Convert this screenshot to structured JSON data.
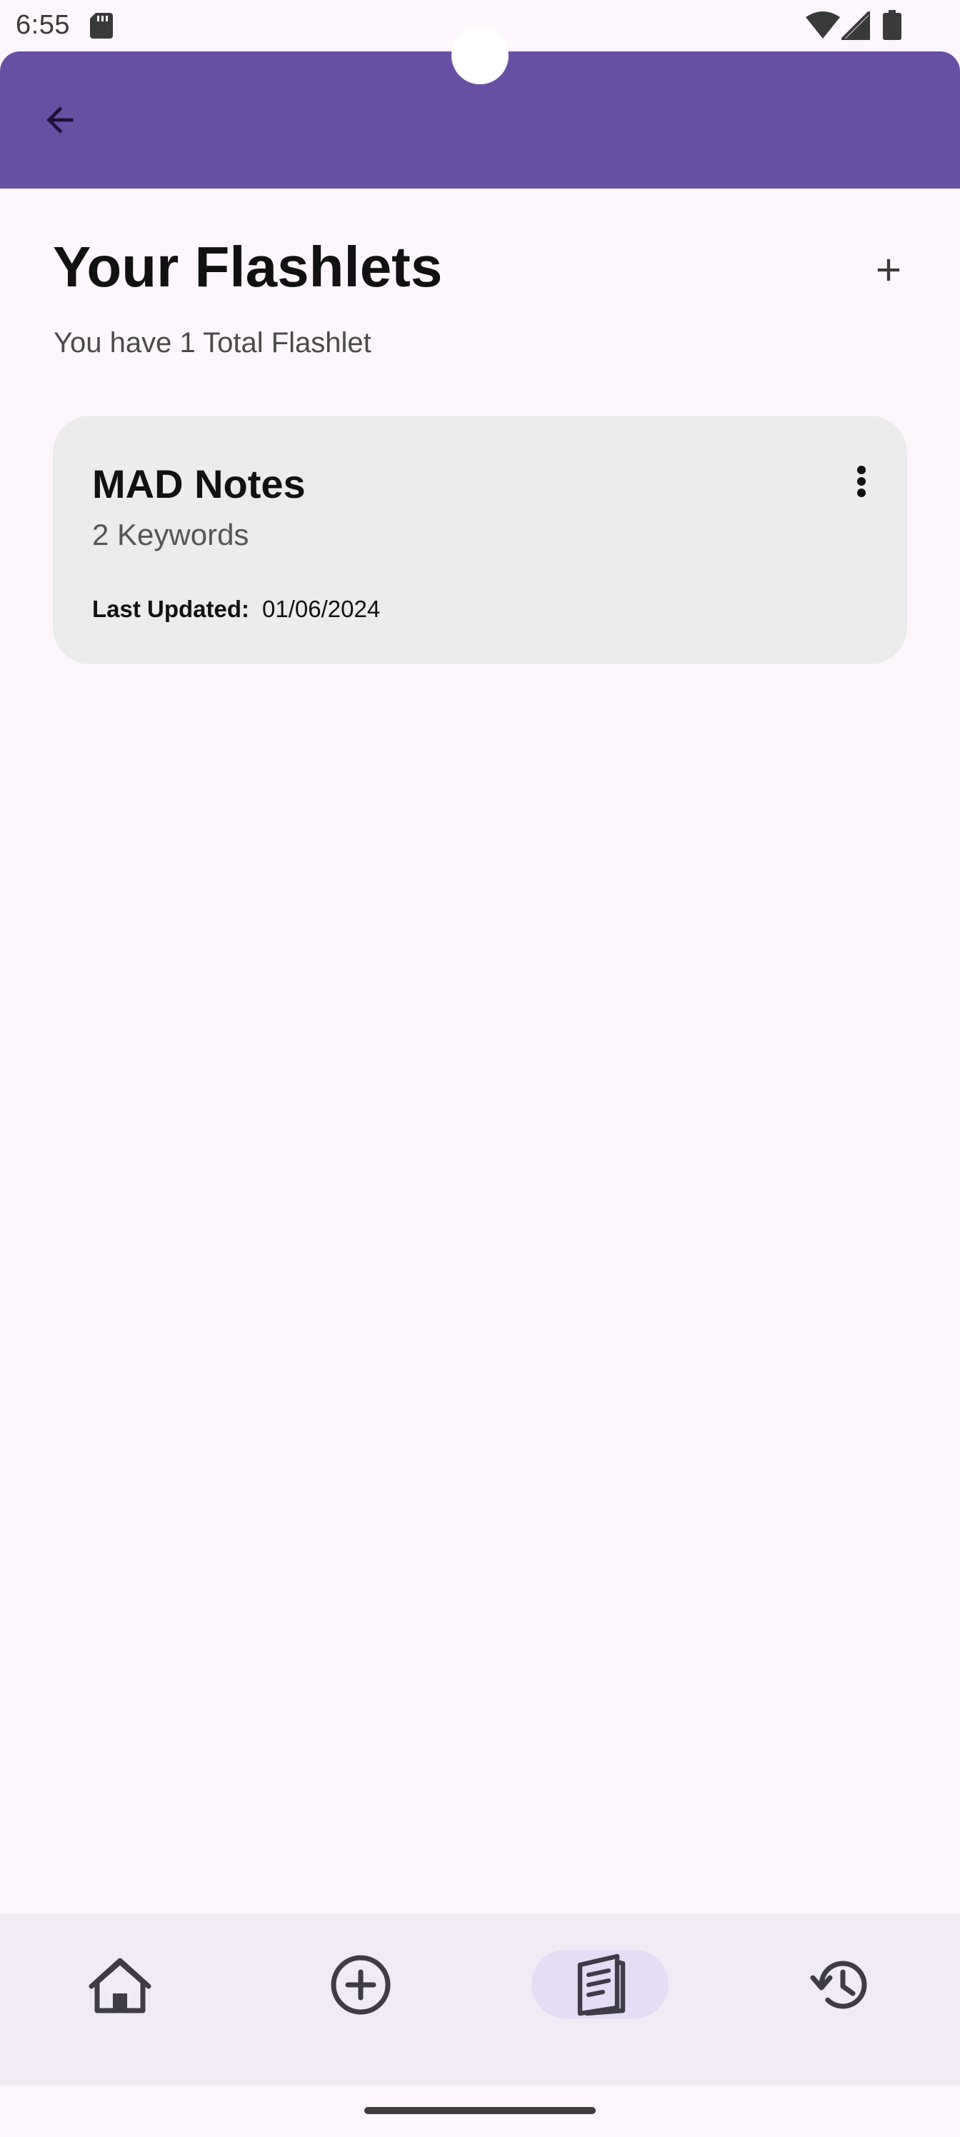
{
  "status_bar": {
    "time": "6:55",
    "icons": [
      "sd-card-icon",
      "wifi-icon",
      "signal-icon",
      "battery-icon"
    ]
  },
  "app_bar": {
    "back_icon": "arrow-back-icon",
    "color": "#674fa3"
  },
  "header": {
    "title": "Your Flashlets",
    "subtitle": "You have 1 Total Flashlet",
    "add_icon": "plus-icon"
  },
  "flashlets": [
    {
      "title": "MAD Notes",
      "keywords": "2 Keywords",
      "last_updated_label": "Last Updated:",
      "last_updated_value": "01/06/2024",
      "menu_icon": "more-vert-icon"
    }
  ],
  "bottom_nav": {
    "items": [
      {
        "name": "home",
        "icon": "home-icon",
        "selected": false
      },
      {
        "name": "create",
        "icon": "add-circle-icon",
        "selected": false
      },
      {
        "name": "flashlets",
        "icon": "flashcard-icon",
        "selected": true
      },
      {
        "name": "history",
        "icon": "history-icon",
        "selected": false
      }
    ],
    "selected_pill_color": "#e5dcf5",
    "background": "#f1ebf6"
  },
  "colors": {
    "background": "#fdf6fc",
    "card": "#ececec",
    "accent": "#674fa3"
  }
}
